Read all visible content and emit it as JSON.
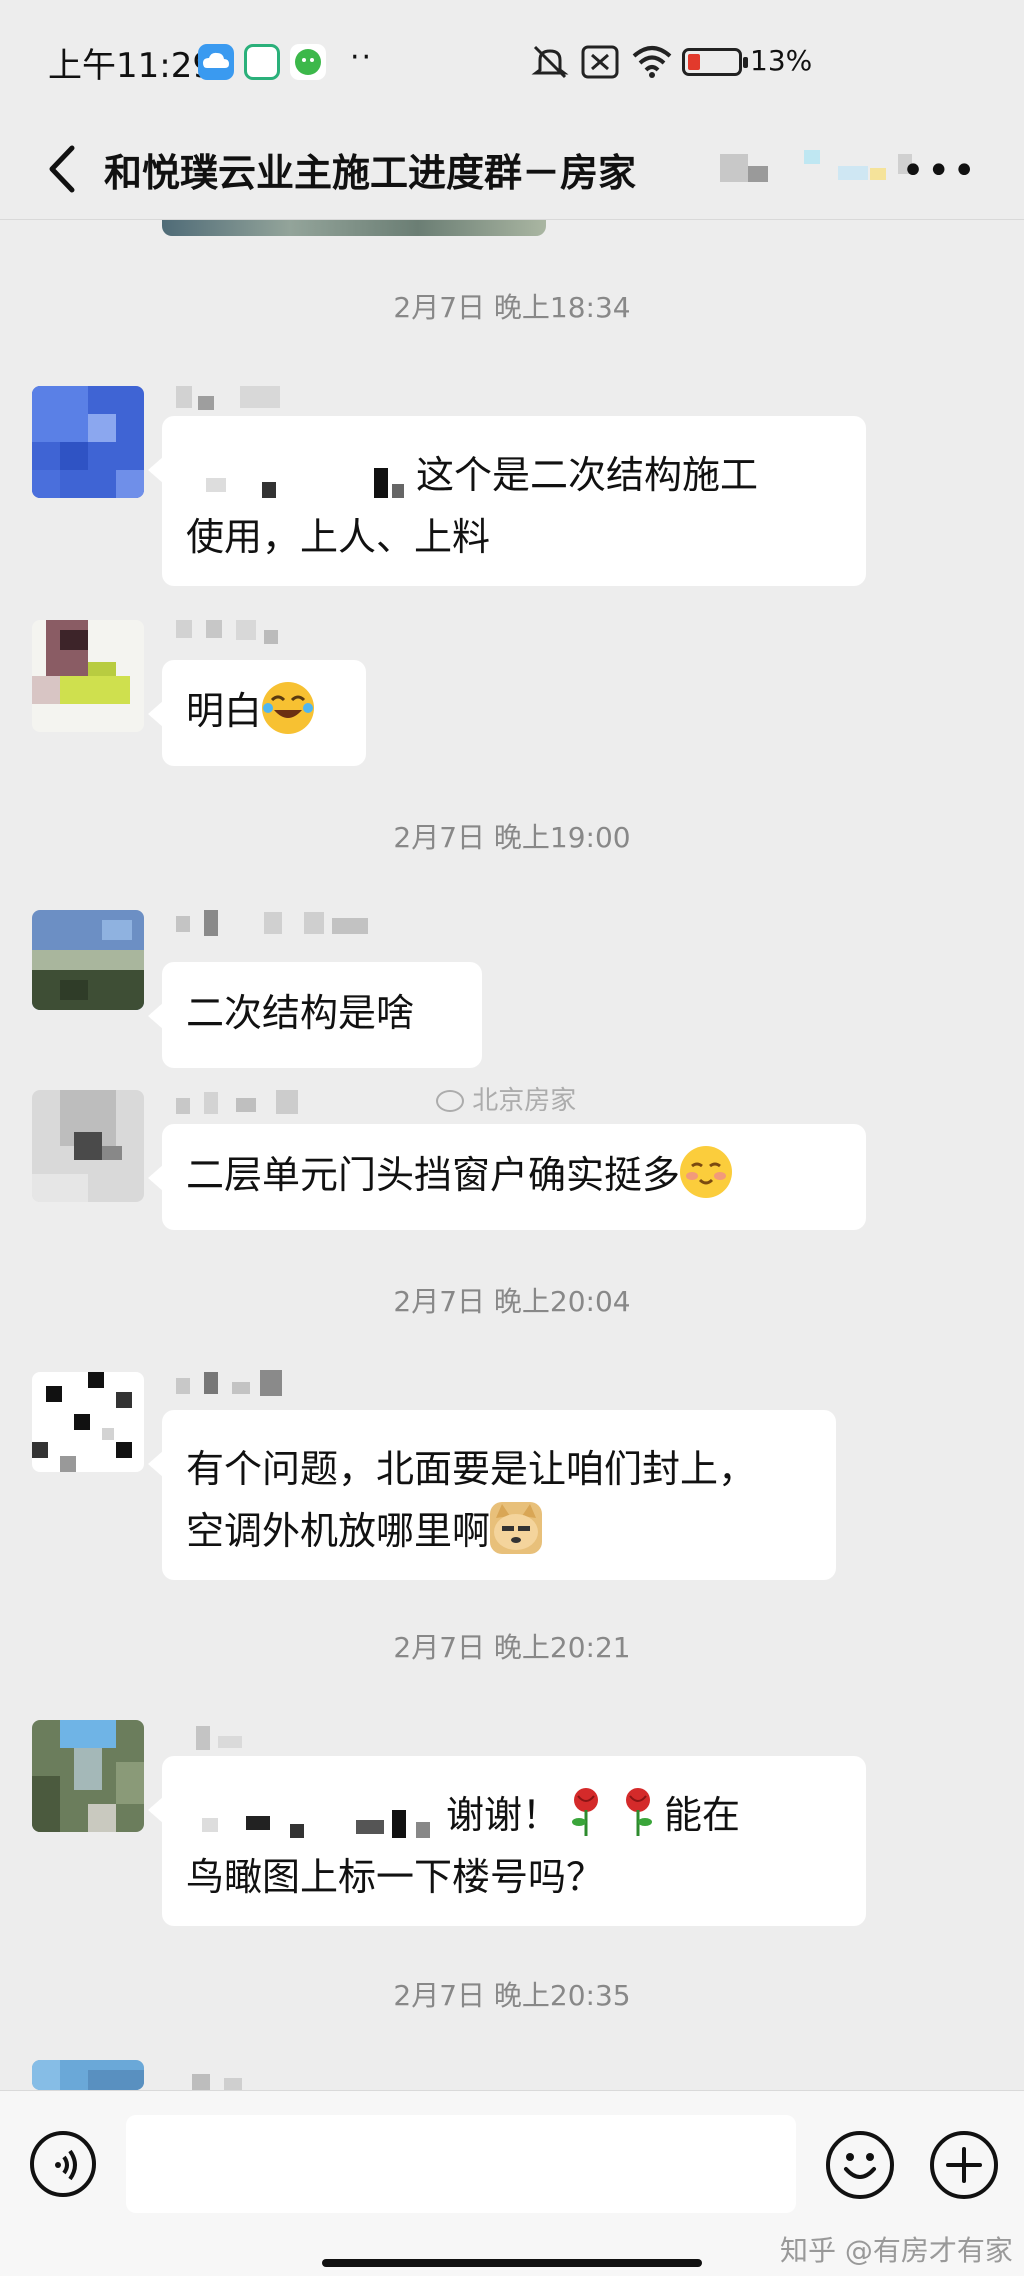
{
  "status_bar": {
    "time": "上午11:29",
    "battery_pct": "13%",
    "battery_level": 0.13,
    "icons": [
      "cloud-icon",
      "chat-app-icon",
      "wechat-app-icon",
      "more-dots-icon",
      "mute-icon",
      "no-sim-icon",
      "wifi-icon",
      "battery-icon"
    ]
  },
  "header": {
    "title": "和悦璞云业主施工进度群－房家",
    "back_icon": "chevron-left-icon",
    "more_icon": "more-horizontal-icon"
  },
  "messages": [
    {
      "timestamp": "2月7日 晚上18:34",
      "lines": [
        "这个是二次结构施工",
        "使用，上人、上料"
      ]
    },
    {
      "lines": [
        "明白"
      ],
      "emoji": "laughing-tears-emoji"
    },
    {
      "timestamp": "2月7日 晚上19:00",
      "lines": [
        "二次结构是啥"
      ]
    },
    {
      "lines": [
        "二层单元门头挡窗户确实挺多"
      ],
      "emoji": "blushing-smile-emoji"
    },
    {
      "timestamp": "2月7日 晚上20:04",
      "lines": [
        "有个问题，北面要是让咱们封上，",
        "空调外机放哪里啊"
      ],
      "emoji": "doge-emoji"
    },
    {
      "timestamp": "2月7日 晚上20:21",
      "lines": [
        "谢谢！",
        "能在",
        "鸟瞰图上标一下楼号吗？"
      ],
      "emoji": "rose-emoji"
    },
    {
      "timestamp": "2月7日 晚上20:35"
    }
  ],
  "watermark": "北京房家",
  "bottom": {
    "voice_icon": "voice-icon",
    "emoji_icon": "emoji-icon",
    "plus_icon": "plus-icon",
    "credit": "知乎 @有房才有家"
  },
  "colors": {
    "background": "#ededed",
    "bubble": "#ffffff",
    "timestamp": "#888888",
    "battery_low": "#e23a2c"
  }
}
